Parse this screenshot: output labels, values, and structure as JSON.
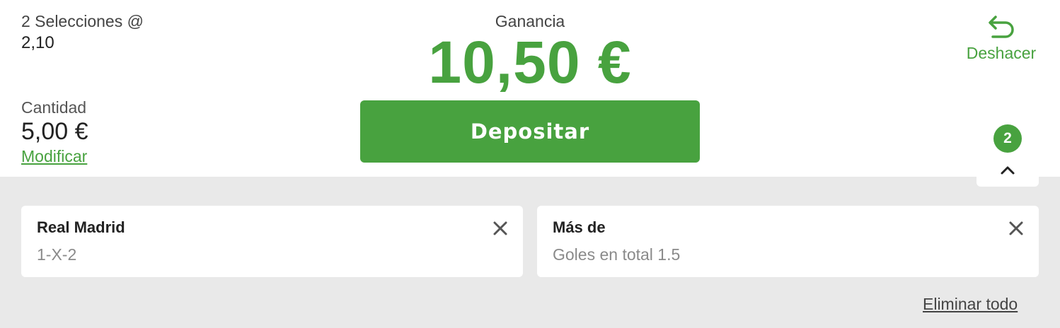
{
  "summary": {
    "selections_label": "2 Selecciones @",
    "odds": "2,10",
    "amount_label": "Cantidad",
    "amount_value": "5,00 €",
    "modify_link": "Modificar"
  },
  "gain": {
    "label": "Ganancia",
    "value": "10,50 €"
  },
  "deposit_button": "Depositar",
  "undo": {
    "label": "Deshacer",
    "icon": "undo-arrow-icon"
  },
  "toggle": {
    "count": "2",
    "icon": "chevron-up-icon"
  },
  "selections": [
    {
      "title": "Real Madrid",
      "market": "1-X-2",
      "close_icon": "close-icon"
    },
    {
      "title": "Más de",
      "market": "Goles en total 1.5",
      "close_icon": "close-icon"
    }
  ],
  "delete_all": "Eliminar todo",
  "colors": {
    "accent": "#48a23f",
    "background_panel": "#e9e9e9",
    "card": "#ffffff"
  }
}
